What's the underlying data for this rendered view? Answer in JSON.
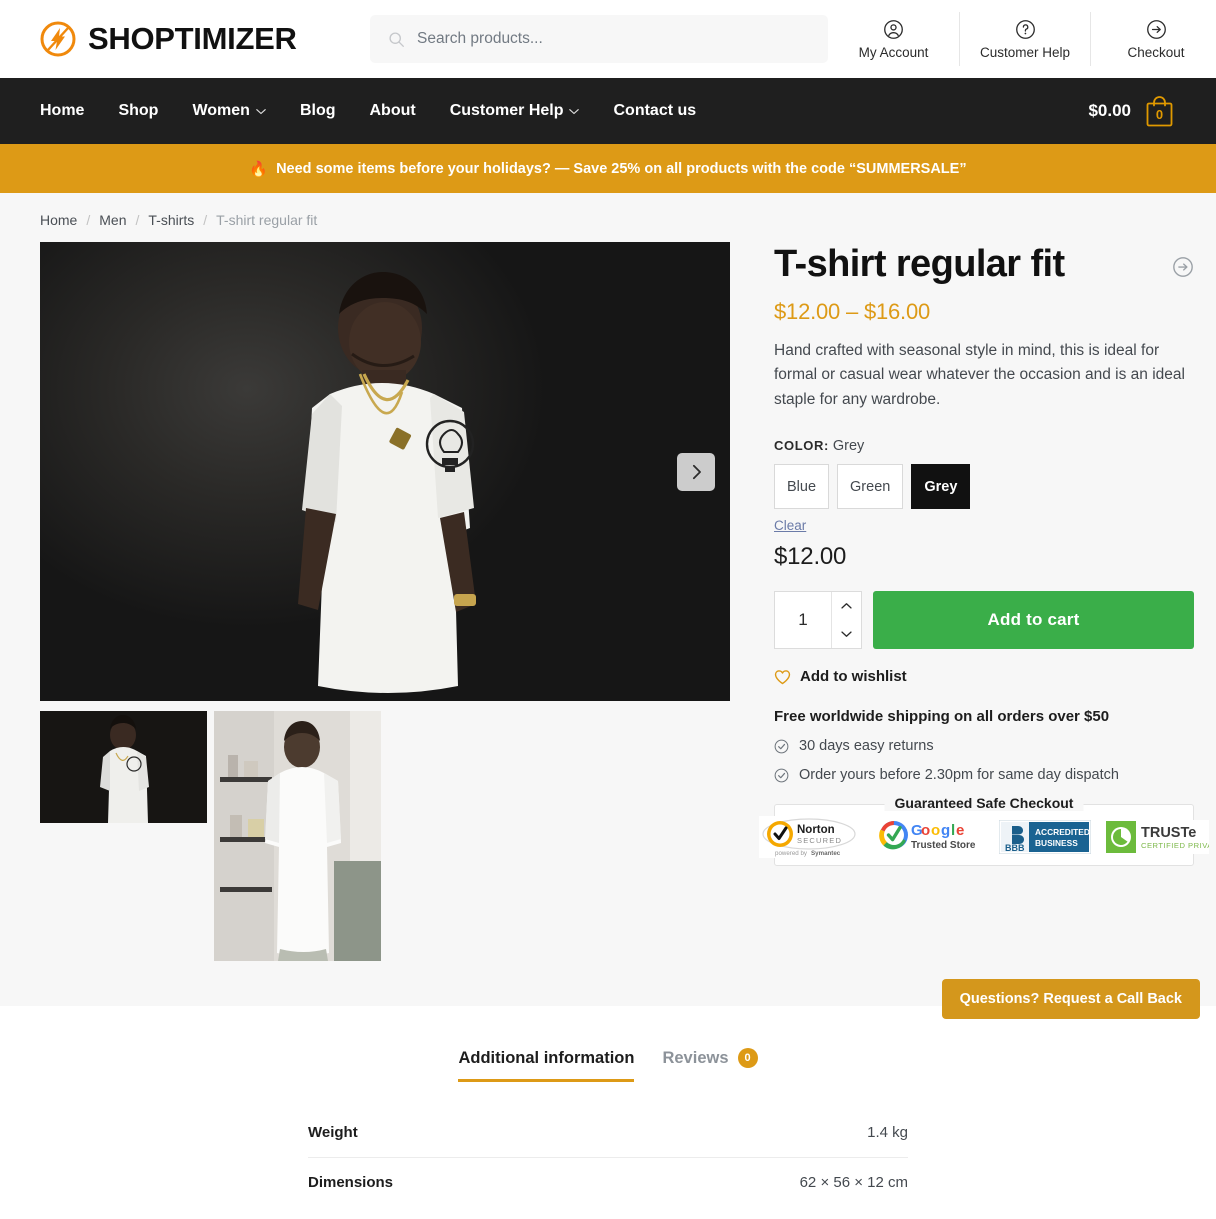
{
  "header": {
    "brand_name": "SHOPTIMIZER",
    "brand_icon": "lightning-bolt-logo",
    "search": {
      "placeholder": "Search products...",
      "value": "",
      "icon": "search-icon"
    },
    "actions": [
      {
        "label": "My Account",
        "icon": "user-circle-icon"
      },
      {
        "label": "Customer Help",
        "icon": "question-circle-icon"
      },
      {
        "label": "Checkout",
        "icon": "arrow-right-circle-icon"
      }
    ]
  },
  "nav": {
    "items": [
      {
        "label": "Home",
        "has_dropdown": false
      },
      {
        "label": "Shop",
        "has_dropdown": false
      },
      {
        "label": "Women",
        "has_dropdown": true
      },
      {
        "label": "Blog",
        "has_dropdown": false
      },
      {
        "label": "About",
        "has_dropdown": false
      },
      {
        "label": "Customer Help",
        "has_dropdown": true
      },
      {
        "label": "Contact us",
        "has_dropdown": false
      }
    ],
    "cart": {
      "total": "$0.00",
      "count": "0",
      "icon": "shopping-bag-icon"
    }
  },
  "promo": {
    "emoji": "🔥",
    "text": "Need some items before your holidays? — Save 25% on all products with the code “SUMMERSALE”"
  },
  "breadcrumb": {
    "items": [
      "Home",
      "Men",
      "T-shirts"
    ],
    "current": "T-shirt regular fit",
    "separator": "/"
  },
  "gallery": {
    "next_label": "Next image",
    "main_alt": "Man wearing white t-shirt with lightbulb print on dark background",
    "thumbs": [
      {
        "alt": "Man in white t-shirt, dark studio background"
      },
      {
        "alt": "Back view of man wearing white t-shirt indoors"
      }
    ]
  },
  "product": {
    "title": "T-shirt regular fit",
    "share_icon": "arrow-right-circle-icon",
    "price_range": "$12.00 – $16.00",
    "description": "Hand crafted with seasonal style in mind, this is ideal for formal or casual wear whatever the occasion and is an ideal staple for any wardrobe.",
    "attribute": {
      "label": "COLOR:",
      "selected": "Grey",
      "options": [
        "Blue",
        "Green",
        "Grey"
      ],
      "clear_label": "Clear"
    },
    "selected_price": "$12.00",
    "quantity": "1",
    "add_to_cart_label": "Add to cart",
    "wishlist_label": "Add to wishlist",
    "wishlist_icon": "heart-icon",
    "free_shipping": "Free worldwide shipping on all orders over $50",
    "features": [
      {
        "text": "30 days easy returns",
        "icon": "check-circle-icon"
      },
      {
        "text": "Order yours before 2.30pm for same day dispatch",
        "icon": "check-circle-icon"
      }
    ],
    "safe_checkout": {
      "title": "Guaranteed Safe Checkout",
      "badges": [
        {
          "name": "Norton",
          "sub": "SECURED",
          "footer": "powered by Symantec"
        },
        {
          "name": "Google",
          "sub": "Trusted Store"
        },
        {
          "name": "BBB",
          "sub": "ACCREDITED BUSINESS"
        },
        {
          "name": "TRUSTe",
          "sub": "CERTIFIED PRIVACY"
        }
      ]
    }
  },
  "callback": {
    "label": "Questions? Request a Call Back"
  },
  "tabs": {
    "items": [
      {
        "label": "Additional information",
        "active": true,
        "badge": null
      },
      {
        "label": "Reviews",
        "active": false,
        "badge": "0"
      }
    ]
  },
  "additional_information": {
    "rows": [
      {
        "label": "Weight",
        "value": "1.4 kg"
      },
      {
        "label": "Dimensions",
        "value": "62 × 56 × 12 cm"
      }
    ]
  },
  "colors": {
    "brand_orange": "#f0890c",
    "promo_bg": "#dd9a16",
    "nav_bg": "#1f1f1f",
    "accent": "#dd9a16",
    "add_to_cart_green": "#3aae49",
    "page_bg": "#f7f7f7",
    "callback_bg": "#d4971c"
  }
}
